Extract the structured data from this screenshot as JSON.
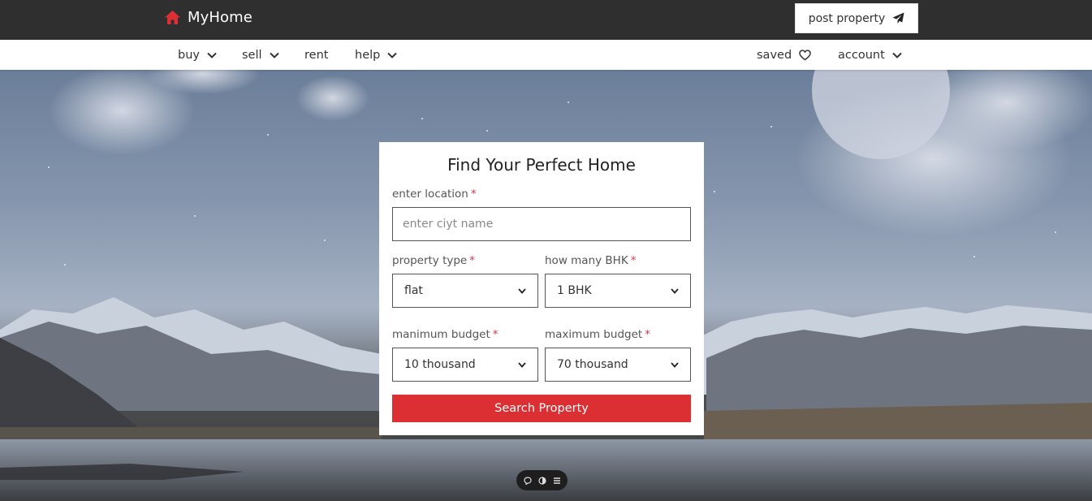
{
  "header": {
    "brand_name": "MyHome",
    "post_property_label": "post property"
  },
  "nav": {
    "left": [
      {
        "label": "buy",
        "has_dropdown": true
      },
      {
        "label": "sell",
        "has_dropdown": true
      },
      {
        "label": "rent",
        "has_dropdown": false
      },
      {
        "label": "help",
        "has_dropdown": true
      }
    ],
    "saved_label": "saved",
    "account_label": "account"
  },
  "search_card": {
    "title": "Find Your Perfect Home",
    "location_label": "enter location",
    "location_placeholder": "enter ciyt name",
    "location_value": "",
    "property_type_label": "property type",
    "property_type_value": "flat",
    "bhk_label": "how many BHK",
    "bhk_value": "1 BHK",
    "min_budget_label": "manimum budget",
    "min_budget_value": "10 thousand",
    "max_budget_label": "maximum budget",
    "max_budget_value": "70 thousand",
    "required_mark": "*",
    "search_button_label": "Search Property"
  },
  "colors": {
    "brand_red": "#dc2f34",
    "topbar": "#2f2f2f"
  },
  "icons": [
    "home-icon",
    "paper-plane-icon",
    "chevron-down-icon",
    "heart-icon",
    "chat-icon",
    "contrast-icon",
    "menu-icon"
  ]
}
